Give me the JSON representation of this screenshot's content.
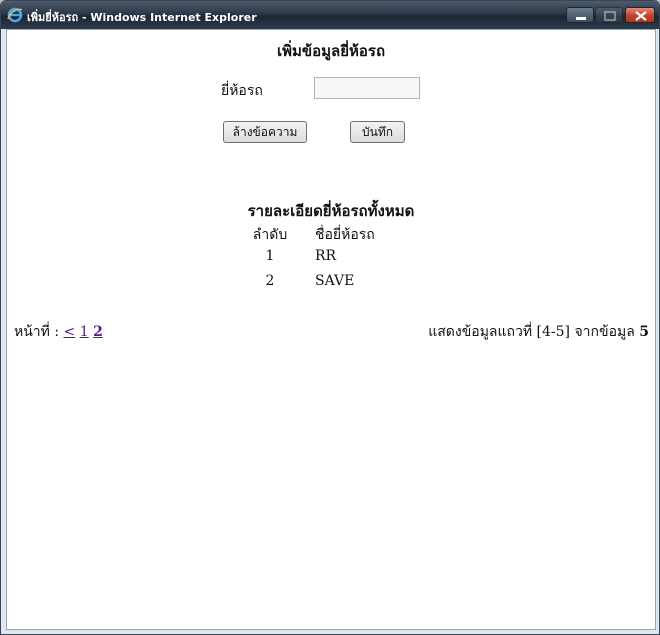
{
  "window": {
    "title": "เพิ่มยี่ห้อรถ - Windows Internet Explorer",
    "app_icon": "internet-explorer-icon"
  },
  "form": {
    "heading": "เพิ่มข้อมูลยี่ห้อรถ",
    "brand_label": "ยี่ห้อรถ",
    "brand_value": "",
    "clear_button": "ล้างข้อความ",
    "save_button": "บันทึก"
  },
  "list": {
    "heading": "รายละเอียดยี่ห้อรถทั้งหมด",
    "columns": [
      "ลำดับ",
      "ชื่อยี่ห้อรถ"
    ],
    "rows": [
      {
        "no": "1",
        "name": "RR"
      },
      {
        "no": "2",
        "name": "SAVE"
      }
    ]
  },
  "pager": {
    "label": "หน้าที่ :",
    "prev": "<",
    "pages": [
      "1",
      "2"
    ],
    "current_page": "2",
    "summary_text": "แสดงข้อมูลแถวที่ [4-5] จากข้อมูล",
    "total": "5"
  },
  "colors": {
    "link": "#551a8b",
    "title_bar": "#2c3948",
    "close_button": "#c2412a"
  }
}
